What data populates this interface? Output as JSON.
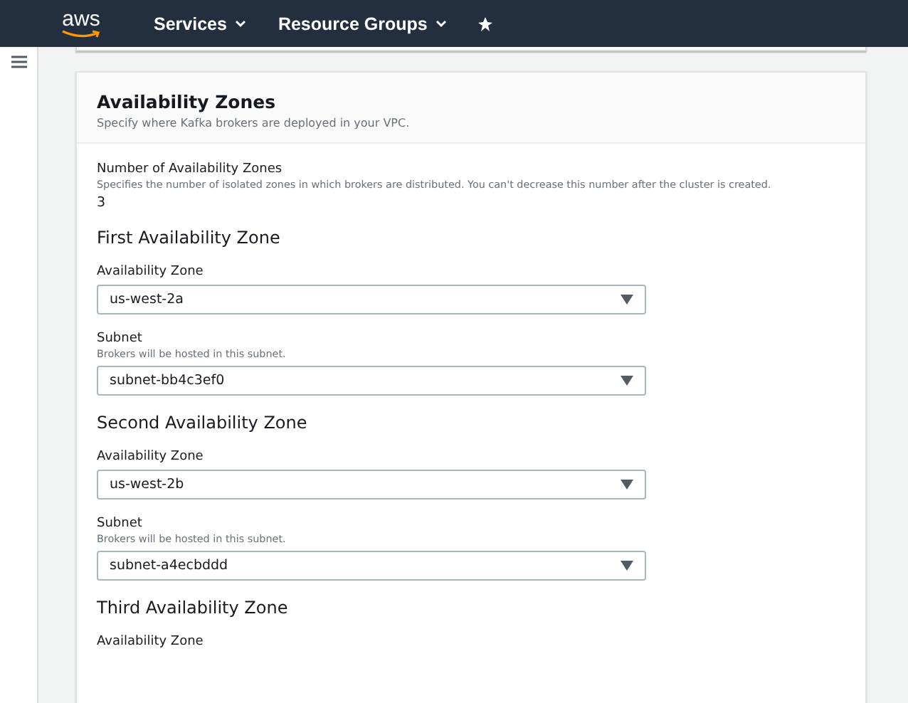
{
  "nav": {
    "logo": "aws",
    "menus": [
      {
        "label": "Services"
      },
      {
        "label": "Resource Groups"
      }
    ]
  },
  "card": {
    "title": "Availability Zones",
    "description": "Specify where Kafka brokers are deployed in your VPC.",
    "count": {
      "label": "Number of Availability Zones",
      "hint": "Specifies the number of isolated zones in which brokers are distributed. You can't decrease this number after the cluster is created.",
      "value": "3"
    },
    "zones": [
      {
        "heading": "First Availability Zone",
        "fields": [
          {
            "label": "Availability Zone",
            "value": "us-west-2a"
          },
          {
            "label": "Subnet",
            "hint": "Brokers will be hosted in this subnet.",
            "value": "subnet-bb4c3ef0"
          }
        ]
      },
      {
        "heading": "Second Availability Zone",
        "fields": [
          {
            "label": "Availability Zone",
            "value": "us-west-2b"
          },
          {
            "label": "Subnet",
            "hint": "Brokers will be hosted in this subnet.",
            "value": "subnet-a4ecbddd"
          }
        ]
      },
      {
        "heading": "Third Availability Zone",
        "fields": [
          {
            "label": "Availability Zone"
          }
        ]
      }
    ]
  }
}
